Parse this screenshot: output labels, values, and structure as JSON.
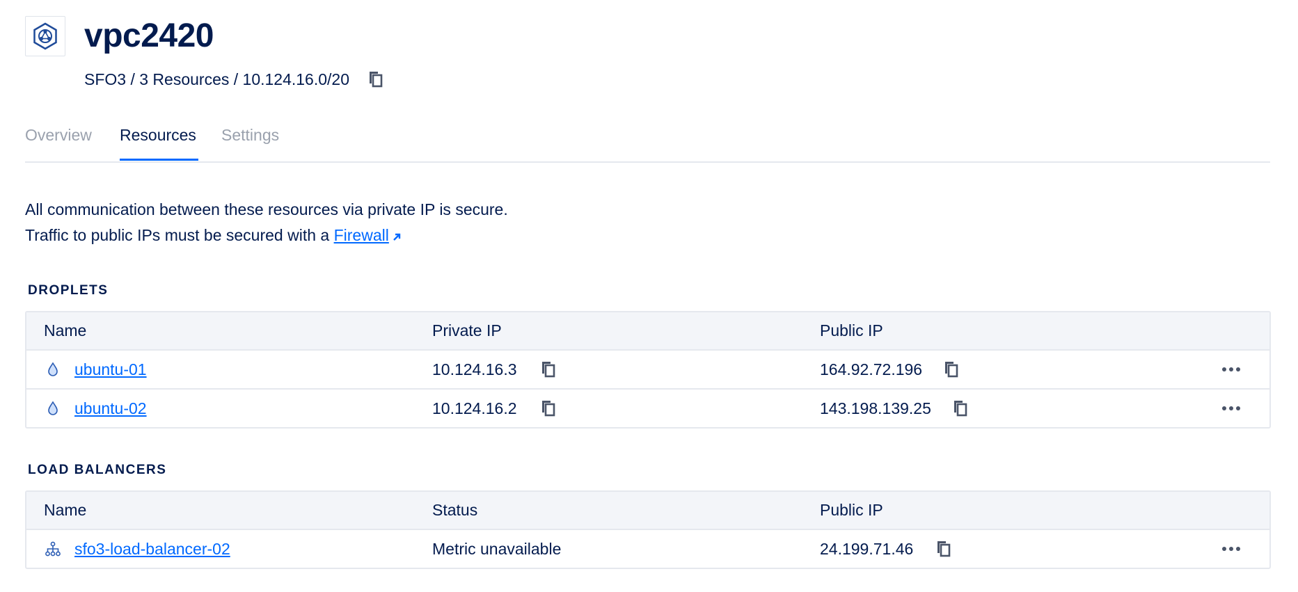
{
  "header": {
    "title": "vpc2420",
    "subtitle": "SFO3 / 3 Resources / 10.124.16.0/20",
    "vpc_icon": "vpc-network-icon",
    "copy_icon": "copy-icon"
  },
  "tabs": [
    {
      "label": "Overview",
      "active": false
    },
    {
      "label": "Resources",
      "active": true
    },
    {
      "label": "Settings",
      "active": false
    }
  ],
  "info": {
    "line1": "All communication between these resources via private IP is secure.",
    "line2_prefix": "Traffic to public IPs must be secured with a",
    "firewall_link": "Firewall"
  },
  "droplets": {
    "title": "DROPLETS",
    "columns": [
      "Name",
      "Private IP",
      "Public IP"
    ],
    "rows": [
      {
        "name": "ubuntu-01",
        "private_ip": "10.124.16.3",
        "public_ip": "164.92.72.196",
        "icon": "droplet-icon"
      },
      {
        "name": "ubuntu-02",
        "private_ip": "10.124.16.2",
        "public_ip": "143.198.139.25",
        "icon": "droplet-icon"
      }
    ]
  },
  "load_balancers": {
    "title": "LOAD BALANCERS",
    "columns": [
      "Name",
      "Status",
      "Public IP"
    ],
    "rows": [
      {
        "name": "sfo3-load-balancer-02",
        "status": "Metric unavailable",
        "public_ip": "24.199.71.46",
        "icon": "load-balancer-icon"
      }
    ]
  },
  "colors": {
    "text": "#031b4e",
    "link": "#0069ff",
    "muted_tab": "#9aa1ad",
    "header_bg": "#f3f5f9",
    "border": "#e5e8ee"
  }
}
